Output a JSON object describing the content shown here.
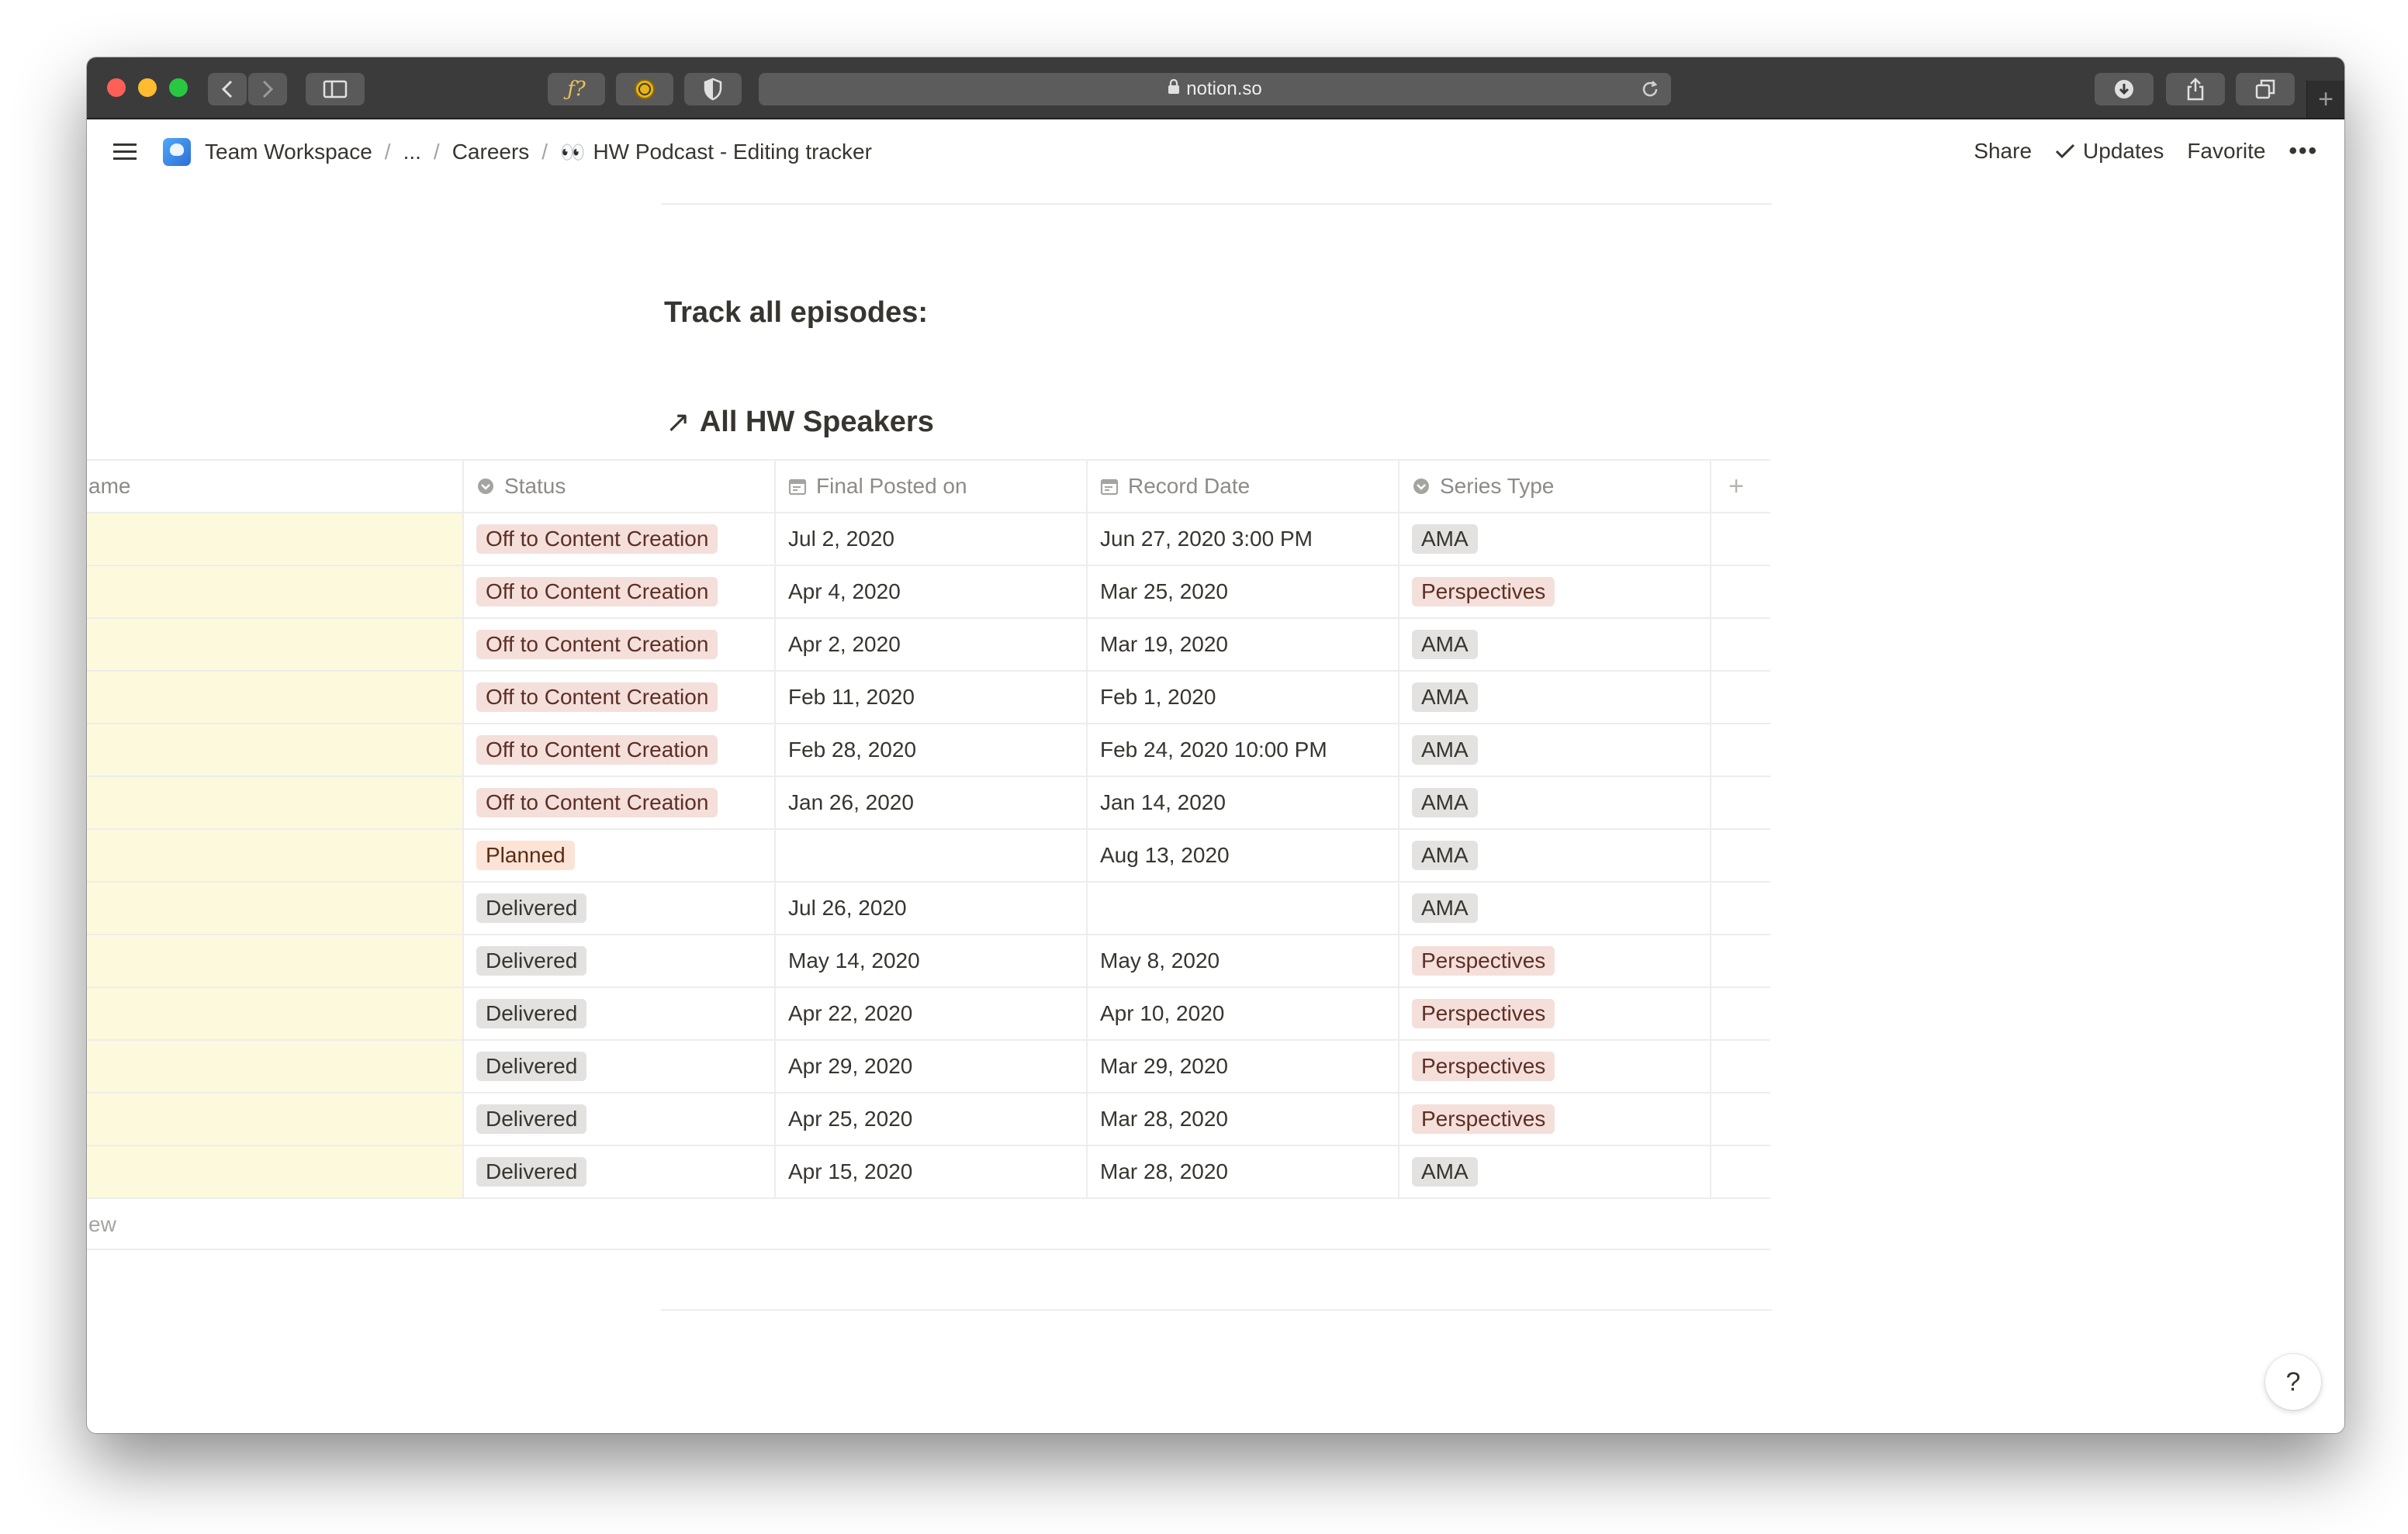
{
  "browser": {
    "url": "notion.so",
    "ext_font_label": "ƒ?"
  },
  "breadcrumb": {
    "workspace": "Team Workspace",
    "ellipsis": "...",
    "careers": "Careers",
    "page_emoji": "👀",
    "page": "HW Podcast - Editing tracker"
  },
  "topbar_actions": {
    "share": "Share",
    "updates": "Updates",
    "favorite": "Favorite",
    "more": "•••"
  },
  "content": {
    "heading": "Track all episodes:",
    "linked_db_arrow": "↗",
    "linked_db_title": "All HW Speakers"
  },
  "table": {
    "columns": {
      "name": "ame",
      "status": "Status",
      "posted": "Final Posted on",
      "record": "Record Date",
      "series": "Series Type",
      "add": "+"
    },
    "rows": [
      {
        "status": "Off to Content Creation",
        "posted": "Jul 2, 2020",
        "record": "Jun 27, 2020 3:00 PM",
        "series": "AMA"
      },
      {
        "status": "Off to Content Creation",
        "posted": "Apr 4, 2020",
        "record": "Mar 25, 2020",
        "series": "Perspectives"
      },
      {
        "status": "Off to Content Creation",
        "posted": "Apr 2, 2020",
        "record": "Mar 19, 2020",
        "series": "AMA"
      },
      {
        "status": "Off to Content Creation",
        "posted": "Feb 11, 2020",
        "record": "Feb 1, 2020",
        "series": "AMA"
      },
      {
        "status": "Off to Content Creation",
        "posted": "Feb 28, 2020",
        "record": "Feb 24, 2020 10:00 PM",
        "series": "AMA"
      },
      {
        "status": "Off to Content Creation",
        "posted": "Jan 26, 2020",
        "record": "Jan 14, 2020",
        "series": "AMA"
      },
      {
        "status": "Planned",
        "posted": "",
        "record": "Aug 13, 2020",
        "series": "AMA"
      },
      {
        "status": "Delivered",
        "posted": "Jul 26, 2020",
        "record": "",
        "series": "AMA"
      },
      {
        "status": "Delivered",
        "posted": "May 14, 2020",
        "record": "May 8, 2020",
        "series": "Perspectives"
      },
      {
        "status": "Delivered",
        "posted": "Apr 22, 2020",
        "record": "Apr 10, 2020",
        "series": "Perspectives"
      },
      {
        "status": "Delivered",
        "posted": "Apr 29, 2020",
        "record": "Mar 29, 2020",
        "series": "Perspectives"
      },
      {
        "status": "Delivered",
        "posted": "Apr 25, 2020",
        "record": "Mar 28, 2020",
        "series": "Perspectives"
      },
      {
        "status": "Delivered",
        "posted": "Apr 15, 2020",
        "record": "Mar 28, 2020",
        "series": "AMA"
      }
    ],
    "new_row_label": "ew"
  },
  "tag_colors": {
    "Off to Content Creation": {
      "bg": "#f4dfdb",
      "fg": "#5d2f24"
    },
    "Planned": {
      "bg": "#fbe3d6",
      "fg": "#5a2c14"
    },
    "Delivered": {
      "bg": "#e3e2e0",
      "fg": "#37352f"
    },
    "AMA": {
      "bg": "#e3e2e0",
      "fg": "#37352f"
    },
    "Perspectives": {
      "bg": "#f4dfdb",
      "fg": "#5d2f24"
    }
  },
  "name_highlight_color": "#fdf9dd",
  "help_label": "?"
}
